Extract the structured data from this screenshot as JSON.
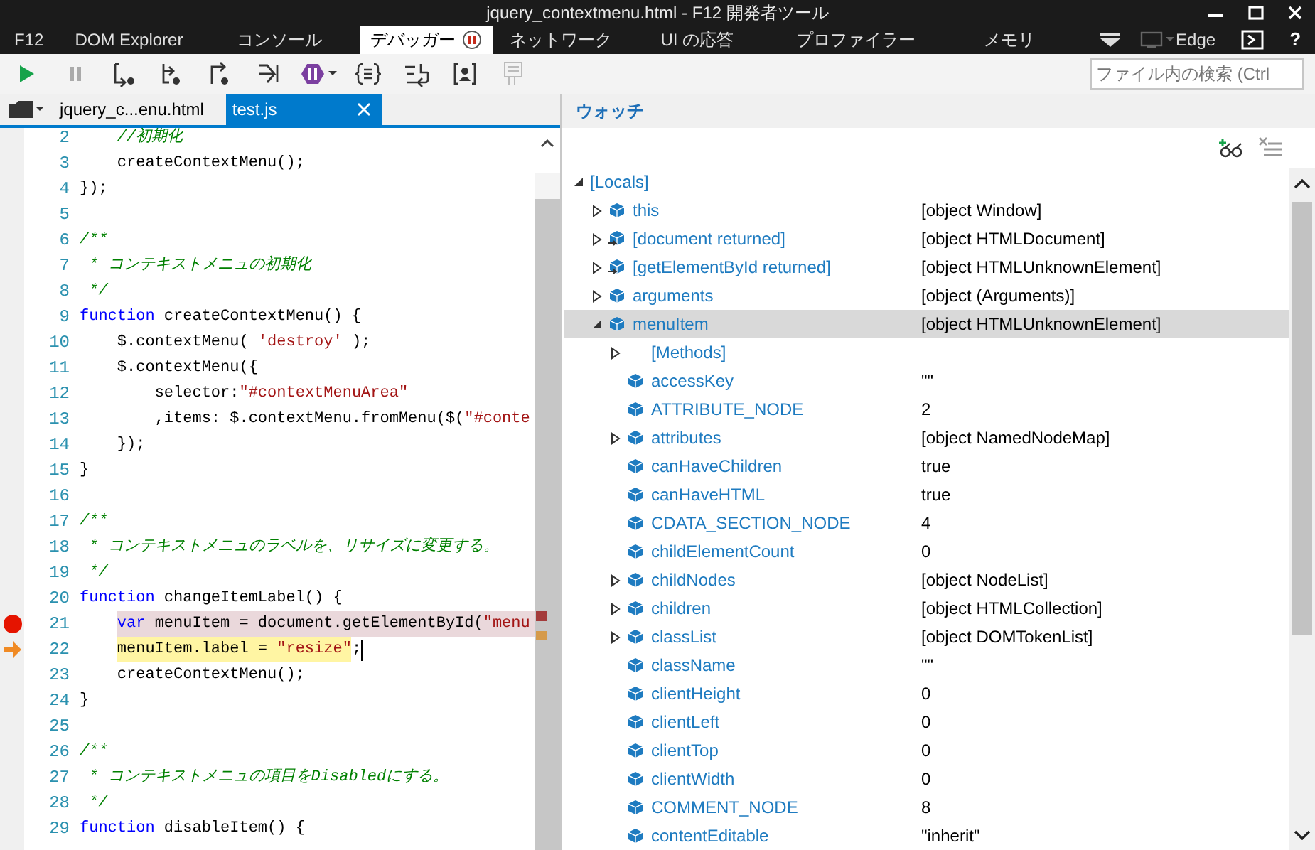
{
  "window": {
    "title": "jquery_contextmenu.html - F12 開発者ツール"
  },
  "tabs": [
    {
      "label": "F12",
      "selected": false,
      "kind": "text"
    },
    {
      "label": "DOM Explorer",
      "selected": false,
      "kind": "text"
    },
    {
      "label": "コンソール",
      "selected": false,
      "kind": "text"
    },
    {
      "label": "デバッガー",
      "selected": true,
      "kind": "paused"
    },
    {
      "label": "ネットワーク",
      "selected": false,
      "kind": "text"
    },
    {
      "label": "UI の応答",
      "selected": false,
      "kind": "text"
    },
    {
      "label": "プロファイラー",
      "selected": false,
      "kind": "text"
    },
    {
      "label": "メモリ",
      "selected": false,
      "kind": "text"
    }
  ],
  "top_right": {
    "emulation_label": "Edge",
    "help_label": "?"
  },
  "search": {
    "placeholder": "ファイル内の検索 (Ctrl"
  },
  "file_tabs": [
    {
      "label": "jquery_c...enu.html",
      "selected": false
    },
    {
      "label": "test.js",
      "selected": true
    }
  ],
  "code": {
    "lines": [
      {
        "number": "2",
        "breakpoint": false,
        "current": false,
        "tokens": [
          {
            "kind": "comment",
            "text": "    //初期化"
          }
        ]
      },
      {
        "number": "3",
        "breakpoint": false,
        "current": false,
        "tokens": [
          {
            "kind": "plain",
            "text": "    createContextMenu();"
          }
        ]
      },
      {
        "number": "4",
        "breakpoint": false,
        "current": false,
        "tokens": [
          {
            "kind": "plain",
            "text": "});"
          }
        ]
      },
      {
        "number": "5",
        "breakpoint": false,
        "current": false
      },
      {
        "number": "6",
        "breakpoint": false,
        "current": false,
        "tokens": [
          {
            "kind": "comment",
            "text": "/**"
          }
        ]
      },
      {
        "number": "7",
        "breakpoint": false,
        "current": false,
        "tokens": [
          {
            "kind": "comment",
            "text": " * コンテキストメニュの初期化"
          }
        ]
      },
      {
        "number": "8",
        "breakpoint": false,
        "current": false,
        "tokens": [
          {
            "kind": "comment",
            "text": " */"
          }
        ]
      },
      {
        "number": "9",
        "breakpoint": false,
        "current": false,
        "tokens": [
          {
            "kind": "keyword",
            "text": "function"
          },
          {
            "kind": "plain",
            "text": " createContextMenu() {"
          }
        ]
      },
      {
        "number": "10",
        "breakpoint": false,
        "current": false,
        "tokens": [
          {
            "kind": "plain",
            "text": "    $.contextMenu( "
          },
          {
            "kind": "string",
            "text": "'destroy'"
          },
          {
            "kind": "plain",
            "text": " );"
          }
        ]
      },
      {
        "number": "11",
        "breakpoint": false,
        "current": false,
        "tokens": [
          {
            "kind": "plain",
            "text": "    $.contextMenu({"
          }
        ]
      },
      {
        "number": "12",
        "breakpoint": false,
        "current": false,
        "tokens": [
          {
            "kind": "plain",
            "text": "        selector:"
          },
          {
            "kind": "string",
            "text": "\"#contextMenuArea\""
          }
        ]
      },
      {
        "number": "13",
        "breakpoint": false,
        "current": false,
        "tokens": [
          {
            "kind": "plain",
            "text": "        ,items: $.contextMenu.fromMenu($("
          },
          {
            "kind": "string",
            "text": "\"#conte"
          }
        ]
      },
      {
        "number": "14",
        "breakpoint": false,
        "current": false,
        "tokens": [
          {
            "kind": "plain",
            "text": "    });"
          }
        ]
      },
      {
        "number": "15",
        "breakpoint": false,
        "current": false,
        "tokens": [
          {
            "kind": "plain",
            "text": "}"
          }
        ]
      },
      {
        "number": "16",
        "breakpoint": false,
        "current": false
      },
      {
        "number": "17",
        "breakpoint": false,
        "current": false,
        "tokens": [
          {
            "kind": "comment",
            "text": "/**"
          }
        ]
      },
      {
        "number": "18",
        "breakpoint": false,
        "current": false,
        "tokens": [
          {
            "kind": "comment",
            "text": " * コンテキストメニュのラベルを、リサイズに変更する。"
          }
        ]
      },
      {
        "number": "19",
        "breakpoint": false,
        "current": false,
        "tokens": [
          {
            "kind": "comment",
            "text": " */"
          }
        ]
      },
      {
        "number": "20",
        "breakpoint": false,
        "current": false,
        "tokens": [
          {
            "kind": "keyword",
            "text": "function"
          },
          {
            "kind": "plain",
            "text": " changeItemLabel() {"
          }
        ]
      },
      {
        "number": "21",
        "breakpoint": true,
        "current": false,
        "tokens": [
          {
            "kind": "keyword",
            "text": "    var"
          },
          {
            "kind": "plain",
            "text": " menuItem = document.getElementById("
          },
          {
            "kind": "string",
            "text": "\"menu"
          }
        ]
      },
      {
        "number": "22",
        "breakpoint": false,
        "current": true,
        "tokens": [
          {
            "kind": "statement",
            "tokens": [
              {
                "kind": "plain",
                "text": "    menuItem.label = "
              },
              {
                "kind": "string",
                "text": "\"resize\""
              }
            ]
          },
          {
            "kind": "plain",
            "text": ";"
          }
        ]
      },
      {
        "number": "23",
        "breakpoint": false,
        "current": false,
        "tokens": [
          {
            "kind": "plain",
            "text": "    createContextMenu();"
          }
        ]
      },
      {
        "number": "24",
        "breakpoint": false,
        "current": false,
        "tokens": [
          {
            "kind": "plain",
            "text": "}"
          }
        ]
      },
      {
        "number": "25",
        "breakpoint": false,
        "current": false
      },
      {
        "number": "26",
        "breakpoint": false,
        "current": false,
        "tokens": [
          {
            "kind": "comment",
            "text": "/**"
          }
        ]
      },
      {
        "number": "27",
        "breakpoint": false,
        "current": false,
        "tokens": [
          {
            "kind": "comment",
            "text": " * コンテキストメニュの項目をDisabledにする。"
          }
        ]
      },
      {
        "number": "28",
        "breakpoint": false,
        "current": false,
        "tokens": [
          {
            "kind": "comment",
            "text": " */"
          }
        ]
      },
      {
        "number": "29",
        "breakpoint": false,
        "current": false,
        "tokens": [
          {
            "kind": "keyword",
            "text": "function"
          },
          {
            "kind": "plain",
            "text": " disableItem() {"
          }
        ]
      }
    ]
  },
  "watch": {
    "title": "ウォッチ",
    "items": [
      {
        "name": "[Locals]",
        "kind": "group",
        "expanded": true,
        "selected": false,
        "children": [
          {
            "name": "this",
            "value": "[object Window]",
            "kind": "property",
            "expanded": false,
            "selected": false
          },
          {
            "name": "[document returned]",
            "value": "[object HTMLDocument]",
            "kind": "returned",
            "expanded": false,
            "selected": false
          },
          {
            "name": "[getElementById returned]",
            "value": "[object HTMLUnknownElement]",
            "kind": "returned",
            "expanded": false,
            "selected": false
          },
          {
            "name": "arguments",
            "value": "[object (Arguments)]",
            "kind": "property",
            "expanded": false,
            "selected": false
          },
          {
            "name": "menuItem",
            "value": "[object HTMLUnknownElement]",
            "kind": "property",
            "expanded": true,
            "selected": true,
            "children": [
              {
                "name": "[Methods]",
                "kind": "group",
                "expanded": false,
                "selected": false
              },
              {
                "name": "accessKey",
                "value": "\"\"",
                "kind": "property",
                "selected": false
              },
              {
                "name": "ATTRIBUTE_NODE",
                "value": "2",
                "kind": "property",
                "selected": false
              },
              {
                "name": "attributes",
                "value": "[object NamedNodeMap]",
                "kind": "property",
                "expanded": false,
                "selected": false
              },
              {
                "name": "canHaveChildren",
                "value": "true",
                "kind": "property",
                "selected": false
              },
              {
                "name": "canHaveHTML",
                "value": "true",
                "kind": "property",
                "selected": false
              },
              {
                "name": "CDATA_SECTION_NODE",
                "value": "4",
                "kind": "property",
                "selected": false
              },
              {
                "name": "childElementCount",
                "value": "0",
                "kind": "property",
                "selected": false
              },
              {
                "name": "childNodes",
                "value": "[object NodeList]",
                "kind": "property",
                "expanded": false,
                "selected": false
              },
              {
                "name": "children",
                "value": "[object HTMLCollection]",
                "kind": "property",
                "expanded": false,
                "selected": false
              },
              {
                "name": "classList",
                "value": "[object DOMTokenList]",
                "kind": "property",
                "expanded": false,
                "selected": false
              },
              {
                "name": "className",
                "value": "\"\"",
                "kind": "property",
                "selected": false
              },
              {
                "name": "clientHeight",
                "value": "0",
                "kind": "property",
                "selected": false
              },
              {
                "name": "clientLeft",
                "value": "0",
                "kind": "property",
                "selected": false
              },
              {
                "name": "clientTop",
                "value": "0",
                "kind": "property",
                "selected": false
              },
              {
                "name": "clientWidth",
                "value": "0",
                "kind": "property",
                "selected": false
              },
              {
                "name": "COMMENT_NODE",
                "value": "8",
                "kind": "property",
                "selected": false
              },
              {
                "name": "contentEditable",
                "value": "\"inherit\"",
                "kind": "property",
                "selected": false
              }
            ]
          }
        ]
      }
    ]
  }
}
